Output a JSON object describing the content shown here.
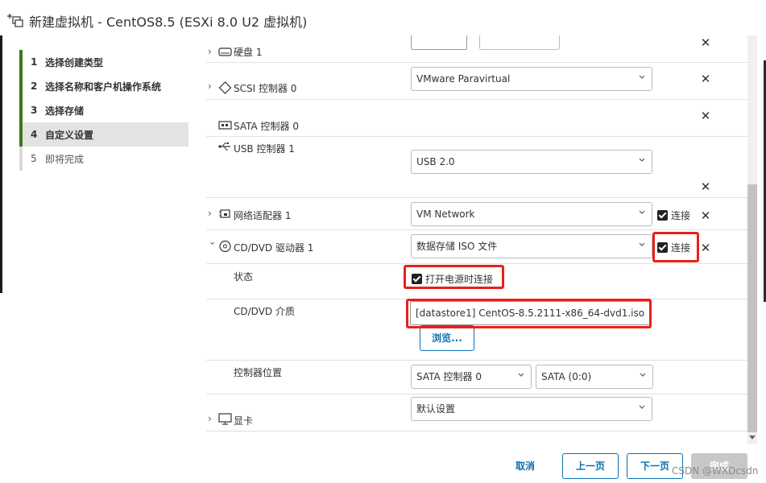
{
  "window": {
    "title": "新建虚拟机 - CentOS8.5 (ESXi 8.0 U2 虚拟机)",
    "icon": "new-vm-icon"
  },
  "steps": [
    {
      "num": "1",
      "label": "选择创建类型",
      "state": "done"
    },
    {
      "num": "2",
      "label": "选择名称和客户机操作系统",
      "state": "done"
    },
    {
      "num": "3",
      "label": "选择存储",
      "state": "done"
    },
    {
      "num": "4",
      "label": "自定义设置",
      "state": "current"
    },
    {
      "num": "5",
      "label": "即将完成",
      "state": "pending"
    }
  ],
  "devices": {
    "disk": {
      "label": "硬盘 1",
      "icon": "disk-icon"
    },
    "scsi": {
      "label": "SCSI 控制器 0",
      "value": "VMware Paravirtual",
      "icon": "diamond-icon"
    },
    "sata": {
      "label": "SATA 控制器 0",
      "icon": "sata-icon"
    },
    "usb": {
      "label": "USB 控制器 1",
      "value": "USB 2.0",
      "icon": "usb-icon"
    },
    "network": {
      "label": "网络适配器 1",
      "value": "VM Network",
      "connect_label": "连接",
      "connect_checked": true,
      "icon": "network-adapter-icon"
    },
    "cddvd": {
      "label": "CD/DVD 驱动器 1",
      "value": "数据存储 ISO 文件",
      "connect_label": "连接",
      "connect_checked": true,
      "icon": "cd-icon",
      "status_label": "状态",
      "power_on_label": "打开电源时连接",
      "power_on_checked": true,
      "media_label": "CD/DVD 介质",
      "media_value": "[datastore1] CentOS-8.5.2111-x86_64-dvd1.iso",
      "browse_label": "浏览...",
      "controller_pos_label": "控制器位置",
      "controller_value": "SATA 控制器 0",
      "port_value": "SATA (0:0)"
    },
    "display": {
      "label": "显卡",
      "value": "默认设置",
      "icon": "monitor-icon"
    }
  },
  "footer": {
    "cancel": "取消",
    "prev": "上一页",
    "next": "下一页",
    "finish": "完成"
  },
  "watermark": "CSDN @WXDcsdn",
  "colors": {
    "accent": "#0a6fb0",
    "step_done": "#3a7a1a",
    "highlight": "#e8201a"
  }
}
